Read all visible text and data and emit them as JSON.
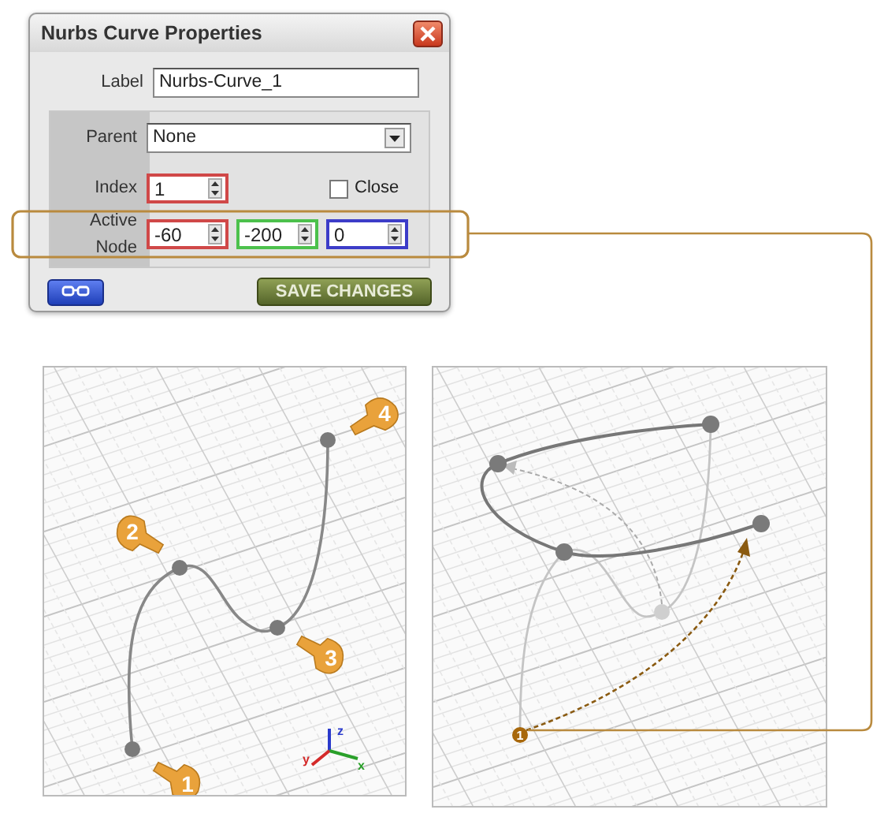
{
  "dialog": {
    "title": "Nurbs Curve Properties",
    "label": {
      "caption": "Label",
      "value": "Nurbs-Curve_1"
    },
    "parent": {
      "caption": "Parent",
      "value": "None"
    },
    "index": {
      "caption": "Index",
      "value": "1"
    },
    "close": {
      "label": "Close",
      "checked": false
    },
    "active_node": {
      "caption": "Active Node",
      "values": [
        {
          "value": "-60",
          "color": "#d04848"
        },
        {
          "value": "-200",
          "color": "#4cc14c"
        },
        {
          "value": "0",
          "color": "#3c3cc8"
        }
      ]
    },
    "save_button": "SAVE CHANGES"
  },
  "diagram_left": {
    "callouts": [
      "1",
      "2",
      "3",
      "4"
    ],
    "axes": [
      "z",
      "y",
      "x"
    ]
  },
  "diagram_right": {
    "marker": "1"
  }
}
